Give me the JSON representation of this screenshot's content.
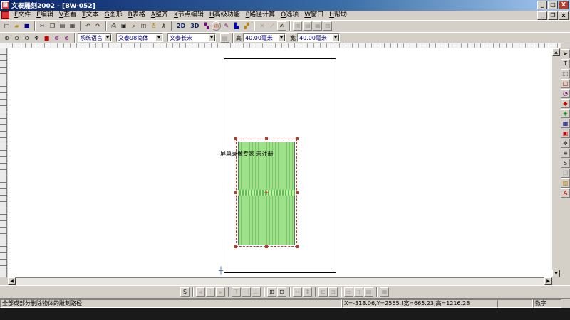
{
  "window": {
    "title": "文泰雕刻2002 - [BW-052]",
    "app_icon_glyph": "雕",
    "buttons": [
      "_",
      "□",
      "X"
    ]
  },
  "menu": {
    "items": [
      {
        "label": "文件",
        "key": "F"
      },
      {
        "label": "编辑",
        "key": "E"
      },
      {
        "label": "查看",
        "key": "V"
      },
      {
        "label": "文本",
        "key": "T"
      },
      {
        "label": "图形",
        "key": "G"
      },
      {
        "label": "表格",
        "key": "B"
      },
      {
        "label": "整齐",
        "key": "A"
      },
      {
        "label": "节点编辑",
        "key": "K"
      },
      {
        "label": "高级功能",
        "key": "H"
      },
      {
        "label": "路径计算",
        "key": "P"
      },
      {
        "label": "选项",
        "key": "O"
      },
      {
        "label": "窗口",
        "key": "W"
      },
      {
        "label": "帮助",
        "key": "H"
      }
    ]
  },
  "toolbar1": {
    "text_buttons": {
      "two_d": "2D",
      "three_d": "3D"
    },
    "icons": [
      "new-icon",
      "open-icon",
      "save-icon",
      "cut-icon",
      "copy-icon",
      "paste-icon",
      "print-icon",
      "undo-icon",
      "redo-icon",
      "print-preview-icon",
      "find-icon",
      "zoom-icon",
      "bulb-icon",
      "key-icon",
      "carve-icon",
      "path-icon",
      "tool-icon",
      "color-icon",
      "grid-icon"
    ]
  },
  "toolbar2": {
    "language_combo": "系统语言",
    "font_combo": "文泰98简体",
    "font_name_combo": "文泰长宋",
    "height_label": "高",
    "height_value": "40.00毫米",
    "width_label": "宽",
    "width_value": "40.00毫米"
  },
  "canvas": {
    "shape_label": "屏幕录像专家 未注册",
    "origin_glyph": "┼"
  },
  "status": {
    "hint": "全部或部分删除物体的雕刻路径",
    "coords": "X=-318.06,Y=2565.!宽=665.23,高=1216.28",
    "mode": "数字"
  },
  "colors": {
    "title_bar": "#0a246a",
    "chrome": "#d4d0c8",
    "shape_fill": "#9fe08a",
    "selection": "#c0392b"
  }
}
